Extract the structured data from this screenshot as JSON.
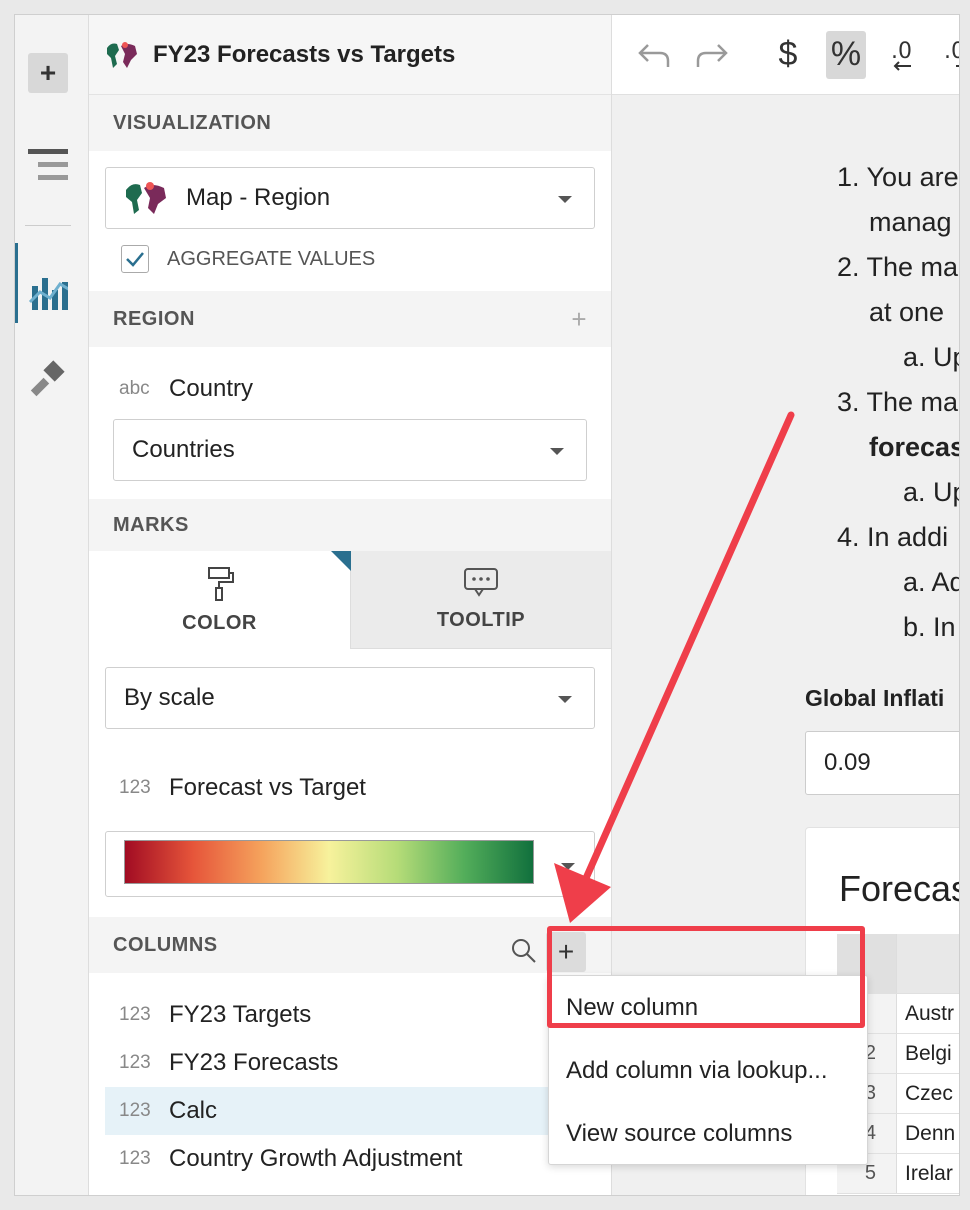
{
  "panel": {
    "title": "FY23 Forecasts vs Targets",
    "visualization_label": "VISUALIZATION",
    "viz_type": "Map - Region",
    "aggregate_label": "AGGREGATE VALUES",
    "region_label": "REGION",
    "region_type": "abc",
    "region_field": "Country",
    "region_select": "Countries",
    "marks_label": "MARKS",
    "tabs": {
      "color": "COLOR",
      "tooltip": "TOOLTIP"
    },
    "color_mode": "By scale",
    "color_field_type": "123",
    "color_field": "Forecast vs Target",
    "columns_label": "COLUMNS",
    "columns": [
      {
        "type": "123",
        "name": "FY23 Targets"
      },
      {
        "type": "123",
        "name": "FY23 Forecasts"
      },
      {
        "type": "123",
        "name": "Calc"
      },
      {
        "type": "123",
        "name": "Country Growth Adjustment"
      }
    ]
  },
  "menu": {
    "items": [
      "New column",
      "Add column via lookup...",
      "View source columns"
    ]
  },
  "main": {
    "list": [
      {
        "kind": "item",
        "text": "1. You are"
      },
      {
        "kind": "cont",
        "text": "manag"
      },
      {
        "kind": "item",
        "text": "2. The ma"
      },
      {
        "kind": "cont",
        "text": "at one"
      },
      {
        "kind": "sub",
        "text": "a. Up"
      },
      {
        "kind": "item",
        "text": "3. The ma"
      },
      {
        "kind": "cont-bold",
        "text": "forecas"
      },
      {
        "kind": "sub",
        "text": "a. Up"
      },
      {
        "kind": "item",
        "text": "4. In addi"
      },
      {
        "kind": "sub",
        "text": "a. Ad"
      },
      {
        "kind": "sub",
        "text": "b. In"
      }
    ],
    "inflation_label": "Global Inflati",
    "inflation_value": "0.09",
    "card_title": "Forecas",
    "table_rows": [
      {
        "num": "",
        "val": "Austr"
      },
      {
        "num": "2",
        "val": "Belgi"
      },
      {
        "num": "3",
        "val": "Czec"
      },
      {
        "num": "4",
        "val": "Denn"
      },
      {
        "num": "5",
        "val": "Irelar"
      }
    ]
  },
  "colors": {
    "accent": "#2a6f8f",
    "annotation_red": "#ef3e4a",
    "highlight_row": "#e6f2f8"
  }
}
